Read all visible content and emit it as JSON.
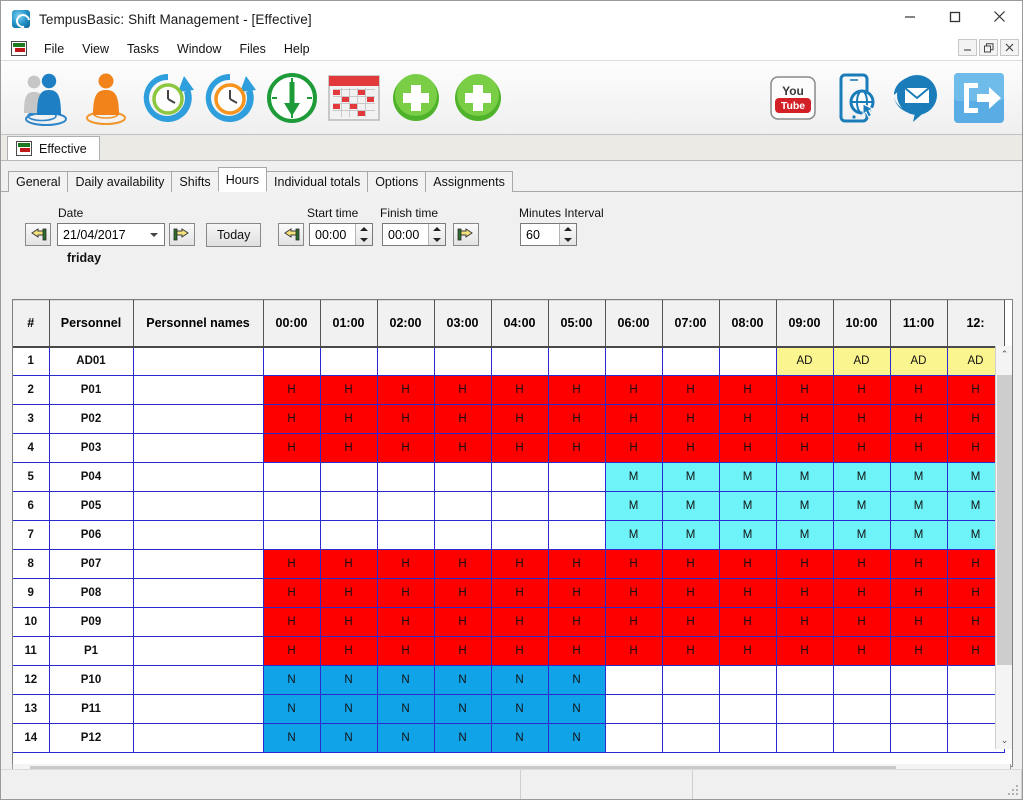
{
  "window": {
    "title": "TempusBasic: Shift Management - [Effective]",
    "app_icon": "tempus-logo-icon",
    "controls": [
      {
        "name": "minimize-button",
        "glyph": "—"
      },
      {
        "name": "maximize-button",
        "glyph": "□"
      },
      {
        "name": "close-button",
        "glyph": "✕"
      }
    ],
    "mdi_controls": [
      {
        "name": "mdi-minimize-button",
        "glyph": "–"
      },
      {
        "name": "mdi-restore-button",
        "glyph": "❐"
      },
      {
        "name": "mdi-close-button",
        "glyph": "✕"
      }
    ]
  },
  "menubar": {
    "icon": "grid-doc-icon",
    "items": [
      "File",
      "View",
      "Tasks",
      "Window",
      "Files",
      "Help"
    ]
  },
  "toolbar": {
    "left_buttons": [
      {
        "name": "personnel-icon",
        "label": "Personnel"
      },
      {
        "name": "single-person-icon",
        "label": "Person"
      },
      {
        "name": "clock-refresh-green-icon",
        "label": "Refresh hours"
      },
      {
        "name": "clock-refresh-orange-icon",
        "label": "Recalculate"
      },
      {
        "name": "clock-download-icon",
        "label": "Download times"
      },
      {
        "name": "calendar-icon",
        "label": "Calendar"
      },
      {
        "name": "add-green-plus-icon",
        "label": "Add"
      },
      {
        "name": "add-green-plus-2-icon",
        "label": "Add 2"
      }
    ],
    "right_buttons": [
      {
        "name": "youtube-icon",
        "label": "YouTube"
      },
      {
        "name": "mobile-web-icon",
        "label": "Mobile web"
      },
      {
        "name": "email-icon",
        "label": "Email"
      },
      {
        "name": "exit-icon",
        "label": "Exit"
      }
    ]
  },
  "mdi_tab": {
    "label": "Effective",
    "icon": "grid-doc-icon"
  },
  "tabs": [
    {
      "label": "General",
      "active": false
    },
    {
      "label": "Daily availability",
      "active": false
    },
    {
      "label": "Shifts",
      "active": false
    },
    {
      "label": "Hours",
      "active": true
    },
    {
      "label": "Individual totals",
      "active": false
    },
    {
      "label": "Options",
      "active": false
    },
    {
      "label": "Assignments",
      "active": false
    }
  ],
  "form": {
    "date_label": "Date",
    "date_value": "21/04/2017",
    "day_name": "friday",
    "today_button": "Today",
    "start_time_label": "Start time",
    "start_time_value": "00:00",
    "finish_time_label": "Finish time",
    "finish_time_value": "00:00",
    "minutes_interval_label": "Minutes Interval",
    "minutes_interval_value": "60",
    "prev_date_icon": "hand-left-icon",
    "next_date_icon": "hand-right-icon",
    "prev_time_icon": "hand-left-icon",
    "next_time_icon": "hand-right-icon"
  },
  "grid": {
    "headers": {
      "num": "#",
      "personnel": "Personnel",
      "names": "Personnel names"
    },
    "hour_columns": [
      "00:00",
      "01:00",
      "02:00",
      "03:00",
      "04:00",
      "05:00",
      "06:00",
      "07:00",
      "08:00",
      "09:00",
      "10:00",
      "11:00",
      "12:"
    ],
    "legend_colors": {
      "H": "#fe0000",
      "M": "#6ef3f9",
      "N": "#11a3e8",
      "AD": "#fbf58f",
      "empty": "#ffffff",
      "gridline": "#2a2ad0"
    },
    "rows": [
      {
        "num": "1",
        "personnel": "AD01",
        "names": "",
        "cells": [
          "",
          "",
          "",
          "",
          "",
          "",
          "",
          "",
          "",
          "AD",
          "AD",
          "AD",
          "AD"
        ]
      },
      {
        "num": "2",
        "personnel": "P01",
        "names": "",
        "cells": [
          "H",
          "H",
          "H",
          "H",
          "H",
          "H",
          "H",
          "H",
          "H",
          "H",
          "H",
          "H",
          "H"
        ]
      },
      {
        "num": "3",
        "personnel": "P02",
        "names": "",
        "cells": [
          "H",
          "H",
          "H",
          "H",
          "H",
          "H",
          "H",
          "H",
          "H",
          "H",
          "H",
          "H",
          "H"
        ]
      },
      {
        "num": "4",
        "personnel": "P03",
        "names": "",
        "cells": [
          "H",
          "H",
          "H",
          "H",
          "H",
          "H",
          "H",
          "H",
          "H",
          "H",
          "H",
          "H",
          "H"
        ]
      },
      {
        "num": "5",
        "personnel": "P04",
        "names": "",
        "cells": [
          "",
          "",
          "",
          "",
          "",
          "",
          "M",
          "M",
          "M",
          "M",
          "M",
          "M",
          "M"
        ]
      },
      {
        "num": "6",
        "personnel": "P05",
        "names": "",
        "cells": [
          "",
          "",
          "",
          "",
          "",
          "",
          "M",
          "M",
          "M",
          "M",
          "M",
          "M",
          "M"
        ]
      },
      {
        "num": "7",
        "personnel": "P06",
        "names": "",
        "cells": [
          "",
          "",
          "",
          "",
          "",
          "",
          "M",
          "M",
          "M",
          "M",
          "M",
          "M",
          "M"
        ]
      },
      {
        "num": "8",
        "personnel": "P07",
        "names": "",
        "cells": [
          "H",
          "H",
          "H",
          "H",
          "H",
          "H",
          "H",
          "H",
          "H",
          "H",
          "H",
          "H",
          "H"
        ]
      },
      {
        "num": "9",
        "personnel": "P08",
        "names": "",
        "cells": [
          "H",
          "H",
          "H",
          "H",
          "H",
          "H",
          "H",
          "H",
          "H",
          "H",
          "H",
          "H",
          "H"
        ]
      },
      {
        "num": "10",
        "personnel": "P09",
        "names": "",
        "cells": [
          "H",
          "H",
          "H",
          "H",
          "H",
          "H",
          "H",
          "H",
          "H",
          "H",
          "H",
          "H",
          "H"
        ]
      },
      {
        "num": "11",
        "personnel": "P1",
        "names": "",
        "cells": [
          "H",
          "H",
          "H",
          "H",
          "H",
          "H",
          "H",
          "H",
          "H",
          "H",
          "H",
          "H",
          "H"
        ]
      },
      {
        "num": "12",
        "personnel": "P10",
        "names": "",
        "cells": [
          "N",
          "N",
          "N",
          "N",
          "N",
          "N",
          "",
          "",
          "",
          "",
          "",
          "",
          ""
        ]
      },
      {
        "num": "13",
        "personnel": "P11",
        "names": "",
        "cells": [
          "N",
          "N",
          "N",
          "N",
          "N",
          "N",
          "",
          "",
          "",
          "",
          "",
          "",
          ""
        ]
      },
      {
        "num": "14",
        "personnel": "P12",
        "names": "",
        "cells": [
          "N",
          "N",
          "N",
          "N",
          "N",
          "N",
          "",
          "",
          "",
          "",
          "",
          "",
          ""
        ]
      }
    ]
  },
  "scrollbars": {
    "vertical": {
      "up": "⌃",
      "down": "⌄"
    },
    "horizontal": {
      "left": "‹",
      "right": "›"
    }
  }
}
